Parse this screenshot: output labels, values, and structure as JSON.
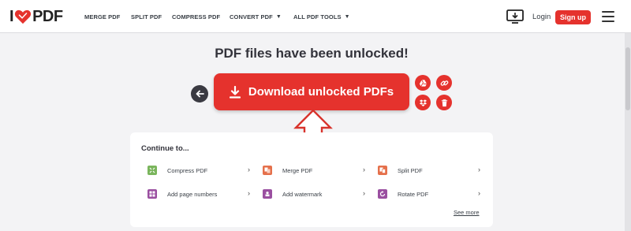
{
  "header": {
    "logo_left": "I",
    "logo_right": "PDF",
    "nav": {
      "merge": "MERGE PDF",
      "split": "SPLIT PDF",
      "compress": "COMPRESS PDF",
      "convert": "CONVERT PDF",
      "all_tools": "ALL PDF TOOLS"
    },
    "caret": "▼",
    "login": "Login",
    "signup": "Sign up"
  },
  "main": {
    "title": "PDF files have been unlocked!",
    "download_label": "Download unlocked PDFs"
  },
  "continue": {
    "title": "Continue to...",
    "chevron": "›",
    "see_more": "See more",
    "tools": [
      {
        "label": "Compress PDF",
        "color": "#7ab55c"
      },
      {
        "label": "Merge PDF",
        "color": "#e5704b"
      },
      {
        "label": "Split PDF",
        "color": "#e5704b"
      },
      {
        "label": "Add page numbers",
        "color": "#9a4fa0"
      },
      {
        "label": "Add watermark",
        "color": "#9a4fa0"
      },
      {
        "label": "Rotate PDF",
        "color": "#9a4fa0"
      }
    ]
  },
  "colors": {
    "brand_red": "#e5322d",
    "dark": "#33333b",
    "background": "#f3f3f5"
  },
  "icons": {
    "download": "download-icon",
    "back": "arrow-left-icon",
    "drive": "google-drive-icon",
    "link": "link-icon",
    "dropbox": "dropbox-icon",
    "delete": "trash-icon",
    "desktop": "desktop-download-icon",
    "menu": "hamburger-menu-icon"
  }
}
